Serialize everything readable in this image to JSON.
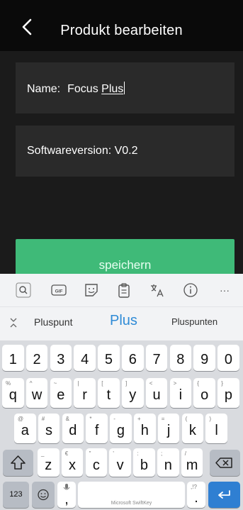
{
  "header": {
    "title": "Produkt bearbeiten"
  },
  "fields": {
    "name_label": "Name:",
    "name_value_plain": "Focus ",
    "name_value_underlined": "Plus",
    "software_version": "Softwareversion: V0.2"
  },
  "save_button": {
    "label": "speichern"
  },
  "keyboard": {
    "suggestions": [
      "Pluspunt",
      "Plus",
      "Pluspunten"
    ],
    "toolbar_icons": [
      "search-icon",
      "gif-icon",
      "sticker-icon",
      "clipboard-icon",
      "translate-icon",
      "info-icon",
      "more-icon"
    ],
    "gif_label": "GIF",
    "more_label": "···",
    "number_row": [
      "1",
      "2",
      "3",
      "4",
      "5",
      "6",
      "7",
      "8",
      "9",
      "0"
    ],
    "row1": [
      {
        "k": "q",
        "h": "%"
      },
      {
        "k": "w",
        "h": "^"
      },
      {
        "k": "e",
        "h": "~"
      },
      {
        "k": "r",
        "h": "|"
      },
      {
        "k": "t",
        "h": "["
      },
      {
        "k": "y",
        "h": "]"
      },
      {
        "k": "u",
        "h": "<"
      },
      {
        "k": "i",
        "h": ">"
      },
      {
        "k": "o",
        "h": "{"
      },
      {
        "k": "p",
        "h": "}"
      }
    ],
    "row2": [
      {
        "k": "a",
        "h": "@"
      },
      {
        "k": "s",
        "h": "#"
      },
      {
        "k": "d",
        "h": "&"
      },
      {
        "k": "f",
        "h": "*"
      },
      {
        "k": "g",
        "h": "-"
      },
      {
        "k": "h",
        "h": "+"
      },
      {
        "k": "j",
        "h": "="
      },
      {
        "k": "k",
        "h": "("
      },
      {
        "k": "l",
        "h": ")"
      }
    ],
    "row3": [
      {
        "k": "z",
        "h": "_"
      },
      {
        "k": "x",
        "h": "€"
      },
      {
        "k": "c",
        "h": "\""
      },
      {
        "k": "v",
        "h": "'"
      },
      {
        "k": "b",
        "h": ":"
      },
      {
        "k": "n",
        "h": ";"
      },
      {
        "k": "m",
        "h": "/"
      }
    ],
    "key_123": "123",
    "key_comma": ",",
    "key_comma_hint": "",
    "key_period": ".",
    "key_period_hint": ",!?",
    "space_label": "Microsoft SwiftKey"
  }
}
